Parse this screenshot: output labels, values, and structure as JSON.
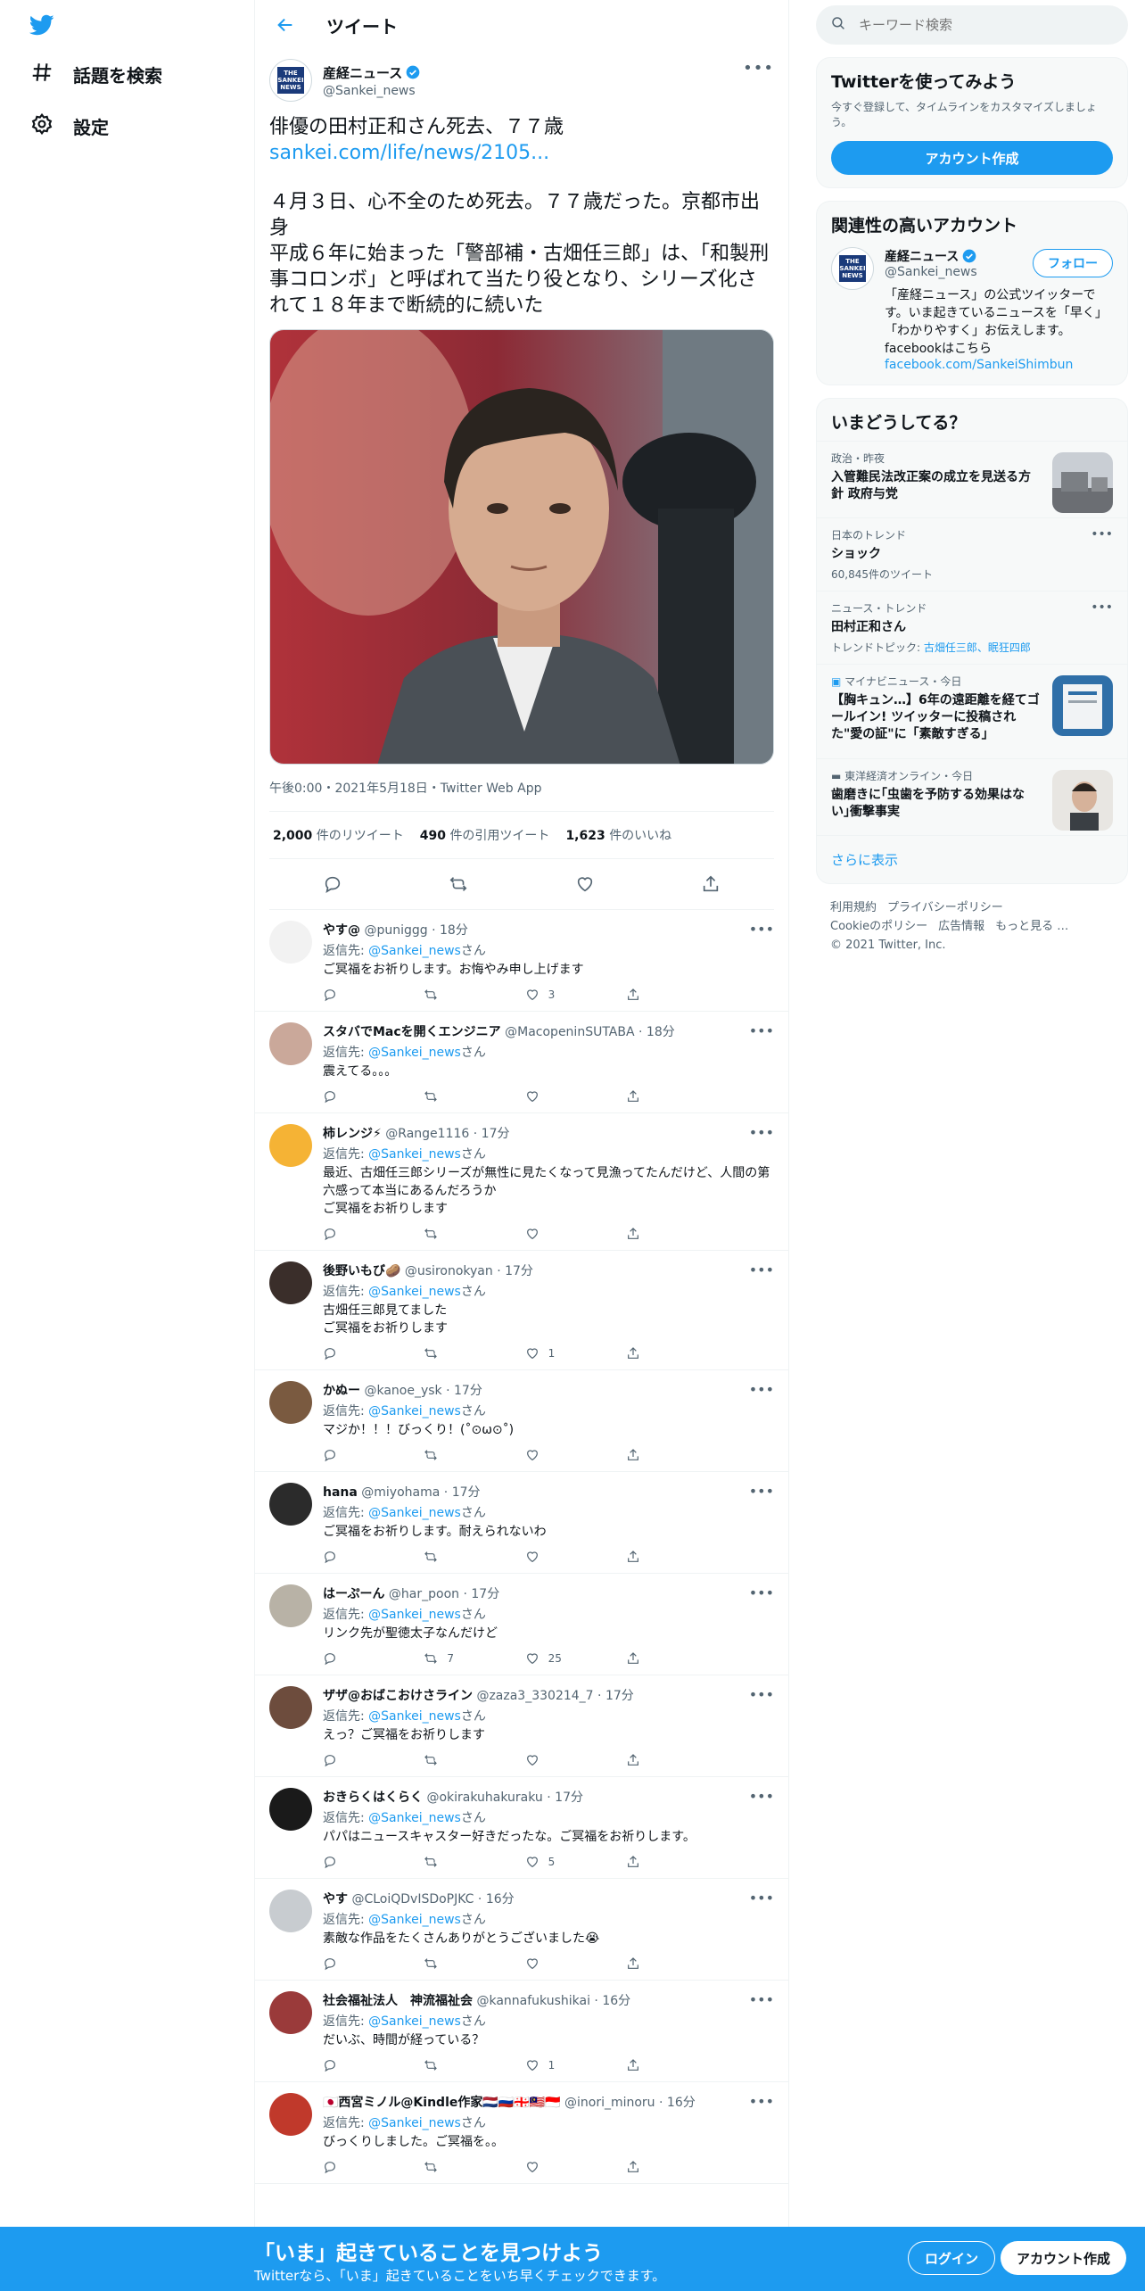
{
  "nav": {
    "explore": "話題を検索",
    "settings": "設定"
  },
  "header": {
    "title": "ツイート"
  },
  "main_tweet": {
    "name": "産経ニュース",
    "handle": "@Sankei_news",
    "headline": "俳優の田村正和さん死去、７７歳",
    "link": "sankei.com/life/news/2105...",
    "body": "４月３日、心不全のため死去。７７歳だった。京都市出身\n平成６年に始まった「警部補・古畑任三郎」は、「和製刑事コロンボ」と呼ばれて当たり役となり、シリーズ化されて１８年まで断続的に続いた",
    "timestamp": "午後0:00・2021年5月18日・Twitter Web App",
    "retweets": "2,000",
    "retweets_label": "件のリツイート",
    "quotes": "490",
    "quotes_label": "件の引用ツイート",
    "likes": "1,623",
    "likes_label": "件のいいね"
  },
  "reply_prefix": "返信先: ",
  "reply_suffix": "さん",
  "replies": [
    {
      "name": "やす@",
      "handle": "@puniggg",
      "time": "18分",
      "to": "@Sankei_news",
      "text": "ご冥福をお祈りします。お悔やみ申し上げます",
      "reply": "",
      "rt": "",
      "like": "3"
    },
    {
      "name": "スタバでMacを開くエンジニア",
      "handle": "@MacopeninSUTABA",
      "time": "18分",
      "to": "@Sankei_news",
      "text": "震えてる。。。",
      "reply": "",
      "rt": "",
      "like": ""
    },
    {
      "name": "柿レンジ⚡",
      "handle": "@Range1116",
      "time": "17分",
      "to": "@Sankei_news",
      "text": "最近、古畑任三郎シリーズが無性に見たくなって見漁ってたんだけど、人間の第六感って本当にあるんだろうか\nご冥福をお祈りします",
      "reply": "",
      "rt": "",
      "like": ""
    },
    {
      "name": "後野いもび🥔",
      "handle": "@usironokyan",
      "time": "17分",
      "to": "@Sankei_news",
      "text": "古畑任三郎見てました\nご冥福をお祈りします",
      "reply": "",
      "rt": "",
      "like": "1"
    },
    {
      "name": "かぬー",
      "handle": "@kanoe_ysk",
      "time": "17分",
      "to": "@Sankei_news",
      "text": "マジか！！！びっくり！(˚⊙ω⊙˚)",
      "reply": "",
      "rt": "",
      "like": ""
    },
    {
      "name": "hana",
      "handle": "@miyohama",
      "time": "17分",
      "to": "@Sankei_news",
      "text": "ご冥福をお祈りします。耐えられないわ",
      "reply": "",
      "rt": "",
      "like": ""
    },
    {
      "name": "はーぷーん",
      "handle": "@har_poon",
      "time": "17分",
      "to": "@Sankei_news",
      "text": "リンク先が聖徳太子なんだけど",
      "reply": "",
      "rt": "7",
      "like": "25"
    },
    {
      "name": "ザザ@おばこおけさライン",
      "handle": "@zaza3_330214_7",
      "time": "17分",
      "to": "@Sankei_news",
      "text": "えっ？ご冥福をお祈りします",
      "reply": "",
      "rt": "",
      "like": ""
    },
    {
      "name": "おきらくはくらく",
      "handle": "@okirakuhakuraku",
      "time": "17分",
      "to": "@Sankei_news",
      "text": "パパはニュースキャスター好きだったな。ご冥福をお祈りします。",
      "reply": "",
      "rt": "",
      "like": "5"
    },
    {
      "name": "やす",
      "handle": "@CLoiQDvISDoPJKC",
      "time": "16分",
      "to": "@Sankei_news",
      "text": "素敵な作品をたくさんありがとうございました😭",
      "reply": "",
      "rt": "",
      "like": ""
    },
    {
      "name": "社会福祉法人　神流福祉会",
      "handle": "@kannafukushikai",
      "time": "16分",
      "to": "@Sankei_news",
      "text": "だいぶ、時間が経っている？",
      "reply": "",
      "rt": "",
      "like": "1"
    },
    {
      "name": "🇯🇵西宮ミノル@Kindle作家🇳🇱🇷🇺🇬🇪🇲🇾🇮🇩",
      "handle": "@inori_minoru",
      "time": "16分",
      "to": "@Sankei_news",
      "text": "びっくりしました。ご冥福を。。",
      "reply": "",
      "rt": "",
      "like": ""
    }
  ],
  "right": {
    "search_placeholder": "キーワード検索",
    "join_title": "Twitterを使ってみよう",
    "join_sub": "今すぐ登録して、タイムラインをカスタマイズしましょう。",
    "join_button": "アカウント作成",
    "related_title": "関連性の高いアカウント",
    "related": {
      "name": "産経ニュース",
      "handle": "@Sankei_news",
      "follow": "フォロー",
      "bio": "「産経ニュース」の公式ツイッターです。いま起きているニュースを「早く」「わかりやすく」お伝えします。facebookはこちら",
      "link": "facebook.com/SankeiShimbun"
    },
    "trends_title": "いまどうしてる？",
    "trends": [
      {
        "ctx": "政治・昨夜",
        "title": "入管難民法改正案の成立を見送る方針 政府与党",
        "sub": ""
      },
      {
        "ctx": "日本のトレンド",
        "title": "ショック",
        "sub": "60,845件のツイート"
      },
      {
        "ctx": "ニュース・トレンド",
        "title": "田村正和さん",
        "sub_prefix": "トレンドトピック: ",
        "sub_links": "古畑任三郎、眠狂四郎"
      },
      {
        "ctx": "マイナビニュース・今日",
        "title": "【胸キュン…】6年の遠距離を経てゴールイン! ツイッターに投稿された\"愛の証\"に「素敵すぎる」",
        "sub": ""
      },
      {
        "ctx": "東洋経済オンライン・今日",
        "title": "歯磨きに｢虫歯を予防する効果はない｣衝撃事実",
        "sub": ""
      }
    ],
    "show_more": "さらに表示",
    "footer": [
      "利用規約",
      "プライバシーポリシー",
      "Cookieのポリシー",
      "広告情報",
      "もっと見る …",
      "© 2021 Twitter, Inc."
    ]
  },
  "bottom_bar": {
    "title": "「いま」起きていることを見つけよう",
    "sub": "Twitterなら、「いま」起きていることをいち早くチェックできます。",
    "login": "ログイン",
    "signup": "アカウント作成"
  },
  "colors": {
    "accent": "#1d9bf0",
    "text": "#0f1419",
    "muted": "#536471",
    "border": "#eff3f4"
  }
}
